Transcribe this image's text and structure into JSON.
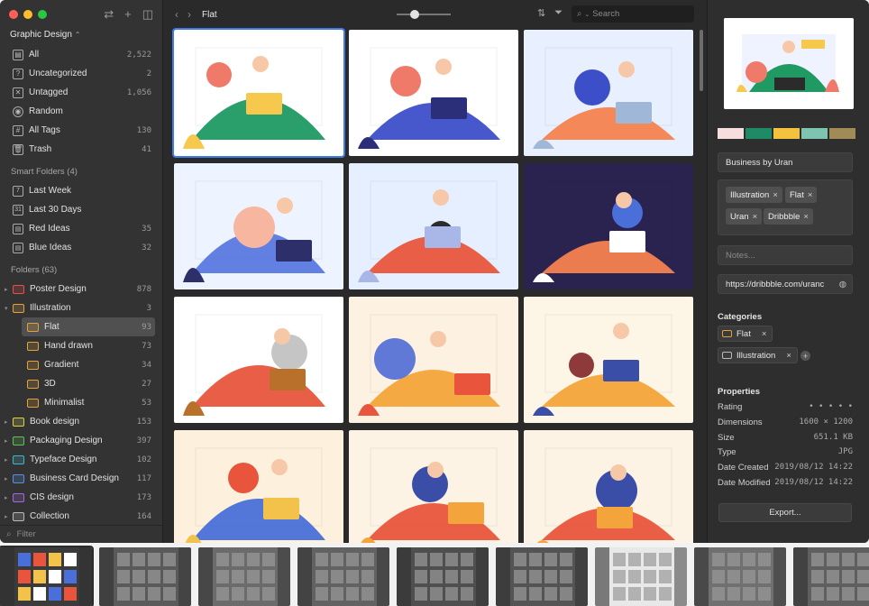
{
  "sidebar": {
    "library_title": "Graphic Design",
    "library_caret": "⌃",
    "items": [
      {
        "label": "All",
        "count": "2,522",
        "icon": "grid-icon"
      },
      {
        "label": "Uncategorized",
        "count": "2",
        "icon": "uncategorized-icon"
      },
      {
        "label": "Untagged",
        "count": "1,056",
        "icon": "untagged-icon"
      },
      {
        "label": "Random",
        "count": "",
        "icon": "random-icon"
      },
      {
        "label": "All Tags",
        "count": "130",
        "icon": "tag-icon"
      },
      {
        "label": "Trash",
        "count": "41",
        "icon": "trash-icon"
      }
    ],
    "smart_header": "Smart Folders (4)",
    "smart": [
      {
        "label": "Last Week",
        "count": "",
        "glyph": "7"
      },
      {
        "label": "Last 30 Days",
        "count": "",
        "glyph": "31"
      },
      {
        "label": "Red Ideas",
        "count": "35",
        "glyph": "▤"
      },
      {
        "label": "Blue Ideas",
        "count": "32",
        "glyph": "▤"
      }
    ],
    "folders_header": "Folders (63)",
    "folders": [
      {
        "label": "Poster Design",
        "count": "878",
        "color": "#e0524c",
        "sub": false
      },
      {
        "label": "Illustration",
        "count": "3",
        "color": "#e2a23b",
        "sub": false,
        "open": true
      },
      {
        "label": "Flat",
        "count": "93",
        "color": "#e2a23b",
        "sub": true,
        "selected": true
      },
      {
        "label": "Hand drawn",
        "count": "73",
        "color": "#e2a23b",
        "sub": true
      },
      {
        "label": "Gradient",
        "count": "34",
        "color": "#e2a23b",
        "sub": true
      },
      {
        "label": "3D",
        "count": "27",
        "color": "#e2a23b",
        "sub": true
      },
      {
        "label": "Minimalist",
        "count": "53",
        "color": "#e2a23b",
        "sub": true
      },
      {
        "label": "Book design",
        "count": "153",
        "color": "#d7d24a",
        "sub": false
      },
      {
        "label": "Packaging Design",
        "count": "397",
        "color": "#5fbf5a",
        "sub": false
      },
      {
        "label": "Typeface Design",
        "count": "102",
        "color": "#3fb7c9",
        "sub": false
      },
      {
        "label": "Business Card Design",
        "count": "117",
        "color": "#5b8fe0",
        "sub": false
      },
      {
        "label": "CIS design",
        "count": "173",
        "color": "#a26ad8",
        "sub": false
      },
      {
        "label": "Collection",
        "count": "164",
        "color": "#b9b9b9",
        "sub": false
      }
    ],
    "filter_placeholder": "Filter"
  },
  "toolbar": {
    "title": "Flat",
    "back": "‹",
    "forward": "›",
    "search_placeholder": "Search",
    "zoom_level": 0.3
  },
  "inspector": {
    "palette": [
      "#f6dede",
      "#1f8a66",
      "#f3c23f",
      "#7fc4b0",
      "#a08a58"
    ],
    "name": "Business by Uran",
    "tags": [
      "Illustration",
      "Flat",
      "Uran",
      "Dribbble"
    ],
    "notes_placeholder": "Notes...",
    "url": "https://dribbble.com/uranc",
    "categories_title": "Categories",
    "categories": [
      "Flat",
      "Illustration"
    ],
    "properties_title": "Properties",
    "properties": [
      {
        "key": "Rating",
        "value": "• • • • •"
      },
      {
        "key": "Dimensions",
        "value": "1600 × 1200"
      },
      {
        "key": "Size",
        "value": "651.1 KB"
      },
      {
        "key": "Type",
        "value": "JPG"
      },
      {
        "key": "Date Created",
        "value": "2019/08/12 14:22"
      },
      {
        "key": "Date Modified",
        "value": "2019/08/12 14:22"
      }
    ],
    "export_label": "Export..."
  },
  "grid": {
    "thumbs": [
      {
        "bg": "#ffffff",
        "a": "#1f9a63",
        "b": "#f07a6a",
        "c": "#f6c84b",
        "selected": true
      },
      {
        "bg": "#ffffff",
        "a": "#3c4fc8",
        "b": "#f07a6a",
        "c": "#2b2f7a"
      },
      {
        "bg": "#e8f0ff",
        "a": "#f4824f",
        "b": "#3c4fc8",
        "c": "#9fb8d8"
      },
      {
        "bg": "#eef4ff",
        "a": "#5a78e0",
        "b": "#f7b6a0",
        "c": "#2d2f6b"
      },
      {
        "bg": "#e6efff",
        "a": "#e8553c",
        "b": "#2b2b2b",
        "c": "#a9b6e8"
      },
      {
        "bg": "#2a2350",
        "a": "#f4824f",
        "b": "#4a6fd8",
        "c": "#ffffff"
      },
      {
        "bg": "#ffffff",
        "a": "#e8553c",
        "b": "#c5c5c5",
        "c": "#b8702a"
      },
      {
        "bg": "#fdf1e1",
        "a": "#f3a43a",
        "b": "#6079d6",
        "c": "#e8553c"
      },
      {
        "bg": "#fdf6e7",
        "a": "#f3a43a",
        "b": "#8f3a3a",
        "c": "#3a4ea8"
      },
      {
        "bg": "#fdf1dd",
        "a": "#4a6fd8",
        "b": "#e8553c",
        "c": "#f3c24b"
      },
      {
        "bg": "#fdf3e4",
        "a": "#e8553c",
        "b": "#3a4ea8",
        "c": "#f3a43a"
      },
      {
        "bg": "#fdf3e4",
        "a": "#e8553c",
        "b": "#3a4ea8",
        "c": "#f3a43a"
      }
    ]
  },
  "strip": {
    "count": 9
  }
}
